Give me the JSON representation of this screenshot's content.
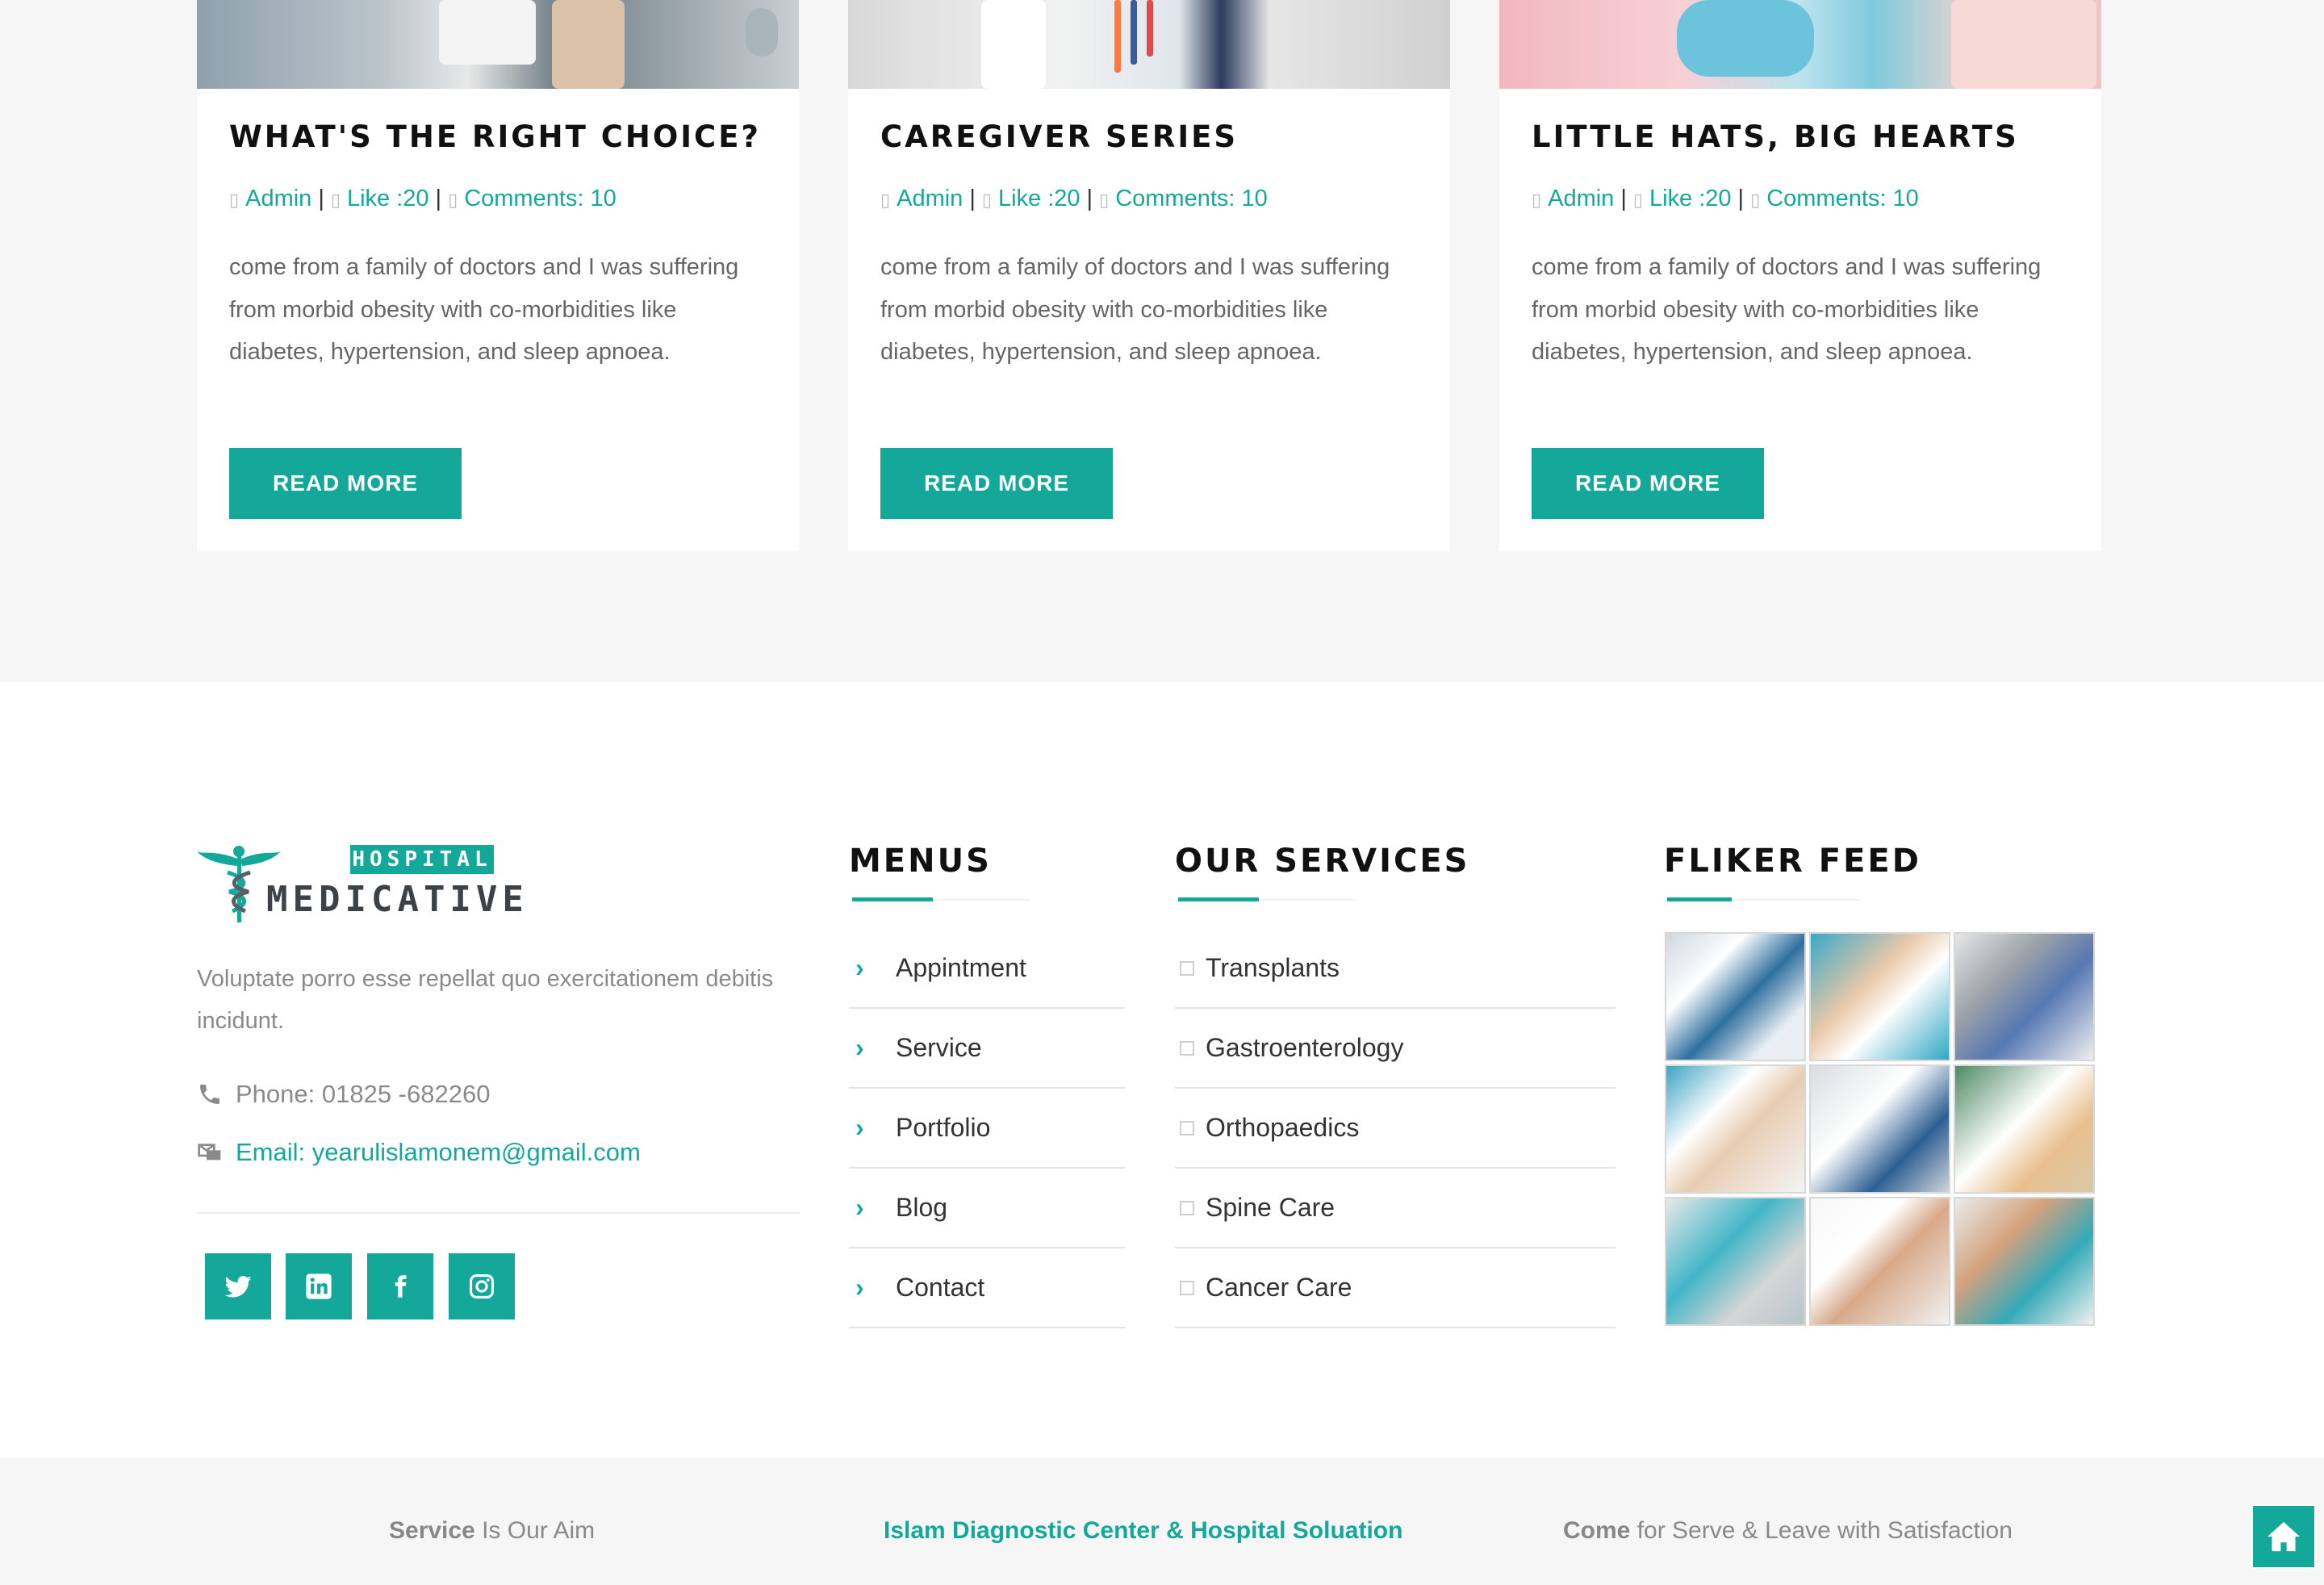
{
  "blog": {
    "cards": [
      {
        "title": "WHAT'S THE RIGHT CHOICE?",
        "author": "Admin",
        "likes": "Like :20",
        "comments": "Comments: 10",
        "excerpt": "come from a family of doctors and I was suffering from morbid obesity with co-morbidities like diabetes, hypertension, and sleep apnoea.",
        "button": "READ MORE"
      },
      {
        "title": "CAREGIVER SERIES",
        "author": "Admin",
        "likes": "Like :20",
        "comments": "Comments: 10",
        "excerpt": "come from a family of doctors and I was suffering from morbid obesity with co-morbidities like diabetes, hypertension, and sleep apnoea.",
        "button": "READ MORE"
      },
      {
        "title": "LITTLE HATS, BIG HEARTS",
        "author": "Admin",
        "likes": "Like :20",
        "comments": "Comments: 10",
        "excerpt": "come from a family of doctors and I was suffering from morbid obesity with co-morbidities like diabetes, hypertension, and sleep apnoea.",
        "button": "READ MORE"
      }
    ],
    "separator": "|",
    "meta_icon_glyph": "▯"
  },
  "footer": {
    "logo": {
      "top": "HOSPITAL",
      "main": "MEDICATIVE",
      "icon": "caduceus-icon"
    },
    "about": "Voluptate porro esse repellat quo exercitationem debitis incidunt.",
    "phone": "Phone: 01825 -682260",
    "email": "Email: yearulislamonem@gmail.com",
    "social": [
      {
        "icon": "twitter-icon"
      },
      {
        "icon": "linkedin-icon"
      },
      {
        "icon": "facebook-icon"
      },
      {
        "icon": "instagram-icon"
      }
    ],
    "menus": {
      "title": "MENUS",
      "chevron": "›",
      "items": [
        "Appintment",
        "Service",
        "Portfolio",
        "Blog",
        "Contact"
      ]
    },
    "services": {
      "title": "OUR SERVICES",
      "items": [
        "Transplants",
        "Gastroenterology",
        "Orthopaedics",
        "Spine Care",
        "Cancer Care"
      ]
    },
    "flickr": {
      "title": "FLIKER FEED",
      "photos": [
        "medical-team",
        "dentist-patient",
        "mri-scan",
        "senior-doctor",
        "lab-equipment",
        "pediatric-checkup",
        "nurse-patient",
        "medical-staff",
        "dental-care"
      ]
    }
  },
  "bottom_bar": {
    "left_bold": "Service",
    "left_rest": " Is Our Aim",
    "center": "Islam Diagnostic Center & Hospital Soluation",
    "right_bold": "Come",
    "right_rest": " for Serve & Leave with Satisfaction",
    "home_icon": "home-icon"
  },
  "colors": {
    "accent": "#14a89a",
    "background_gray": "#f6f6f6",
    "heading": "#111111",
    "body_text": "#666666",
    "muted_text": "#8a8a8a"
  }
}
